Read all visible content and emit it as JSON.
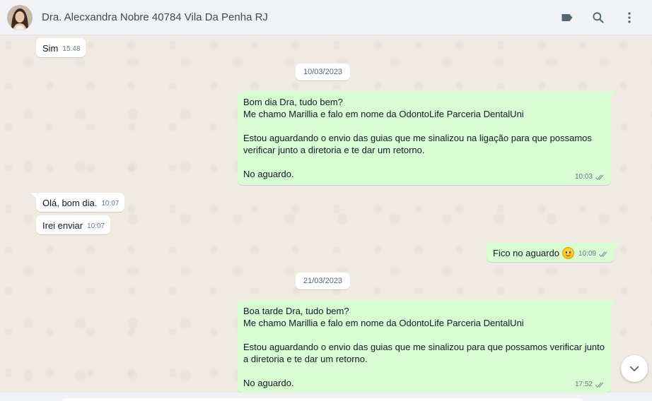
{
  "header": {
    "contact_name": "Dra. Alecxandra Nobre 40784 Vila Da Penha RJ",
    "icons": [
      "label-icon",
      "search-icon",
      "menu-icon"
    ]
  },
  "messages": [
    {
      "dir": "in",
      "text": "Sim",
      "time": "15:48"
    },
    {
      "date": "10/03/2023"
    },
    {
      "dir": "out",
      "text": "Bom dia Dra, tudo bem?\nMe chamo Marillia e falo em nome da OdontoLife Parceria DentalUni\n\nEstou aguardando o envio das guias que me sinalizou na ligação para que possamos verificar junto a diretoria e te dar um retorno.\n\nNo aguardo.",
      "time": "10:03",
      "status": "read"
    },
    {
      "dir": "in",
      "text": "Olá, bom dia.",
      "time": "10:07"
    },
    {
      "dir": "in",
      "text": "Irei enviar",
      "time": "10:07"
    },
    {
      "dir": "out",
      "text": "Fico no aguardo",
      "emoji": "smiling-face",
      "time": "10:09",
      "status": "read"
    },
    {
      "date": "21/03/2023"
    },
    {
      "dir": "out",
      "text": "Boa tarde Dra, tudo bem?\nMe chamo Marillia e falo em nome da OdontoLife Parceria DentalUni\n\nEstou aguardando o envio das guias que me sinalizou para que possamos verificar junto a diretoria e te dar um retorno.\n\nNo aguardo.",
      "time": "17:52",
      "status": "read"
    }
  ],
  "colors": {
    "outgoing_bubble": "#d9fdd3",
    "incoming_bubble": "#ffffff",
    "chat_background": "#efeae2",
    "header_background": "#f0f2f5",
    "read_ticks": "#8696a0"
  }
}
